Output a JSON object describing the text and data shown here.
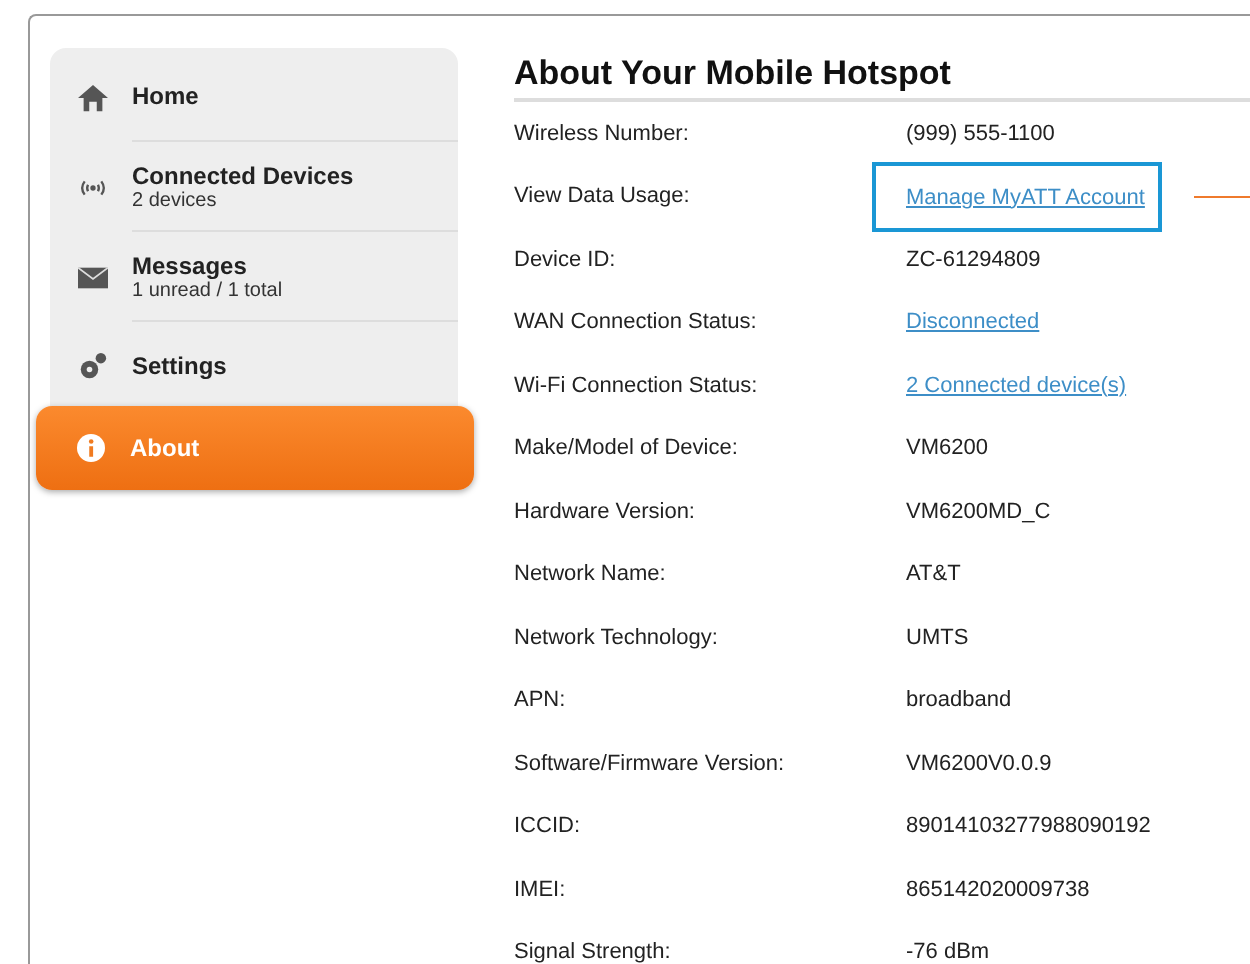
{
  "sidebar": {
    "items": [
      {
        "label": "Home",
        "selected": false
      },
      {
        "label": "Connected Devices",
        "sub": "2 devices",
        "selected": false
      },
      {
        "label": "Messages",
        "sub": "1 unread / 1 total",
        "selected": false
      },
      {
        "label": "Settings",
        "selected": false
      },
      {
        "label": "About",
        "selected": true
      }
    ]
  },
  "content": {
    "title": "About Your Mobile Hotspot",
    "rows": [
      {
        "label": "Wireless Number:",
        "value": "(999) 555-1100",
        "kind": "text",
        "highlighted": false
      },
      {
        "label": "View Data Usage:",
        "value": "Manage MyATT Account",
        "kind": "link",
        "highlighted": true
      },
      {
        "label": "Device ID:",
        "value": "ZC-61294809",
        "kind": "text",
        "highlighted": false
      },
      {
        "label": "WAN Connection Status:",
        "value": "Disconnected",
        "kind": "link",
        "highlighted": false
      },
      {
        "label": "Wi-Fi Connection Status:",
        "value": "2 Connected device(s)",
        "kind": "link",
        "highlighted": false
      },
      {
        "label": "Make/Model of Device:",
        "value": "VM6200",
        "kind": "text",
        "highlighted": false
      },
      {
        "label": "Hardware Version:",
        "value": "VM6200MD_C",
        "kind": "text",
        "highlighted": false
      },
      {
        "label": "Network Name:",
        "value": "AT&T",
        "kind": "text",
        "highlighted": false
      },
      {
        "label": "Network Technology:",
        "value": "UMTS",
        "kind": "text",
        "highlighted": false
      },
      {
        "label": "APN:",
        "value": "broadband",
        "kind": "text",
        "highlighted": false
      },
      {
        "label": "Software/Firmware Version:",
        "value": "VM6200V0.0.9",
        "kind": "text",
        "highlighted": false
      },
      {
        "label": "ICCID:",
        "value": "89014103277988090192",
        "kind": "text",
        "highlighted": false
      },
      {
        "label": "IMEI:",
        "value": "865142020009738",
        "kind": "text",
        "highlighted": false
      },
      {
        "label": "Signal Strength:",
        "value": "-76 dBm",
        "kind": "text",
        "highlighted": false
      }
    ]
  }
}
